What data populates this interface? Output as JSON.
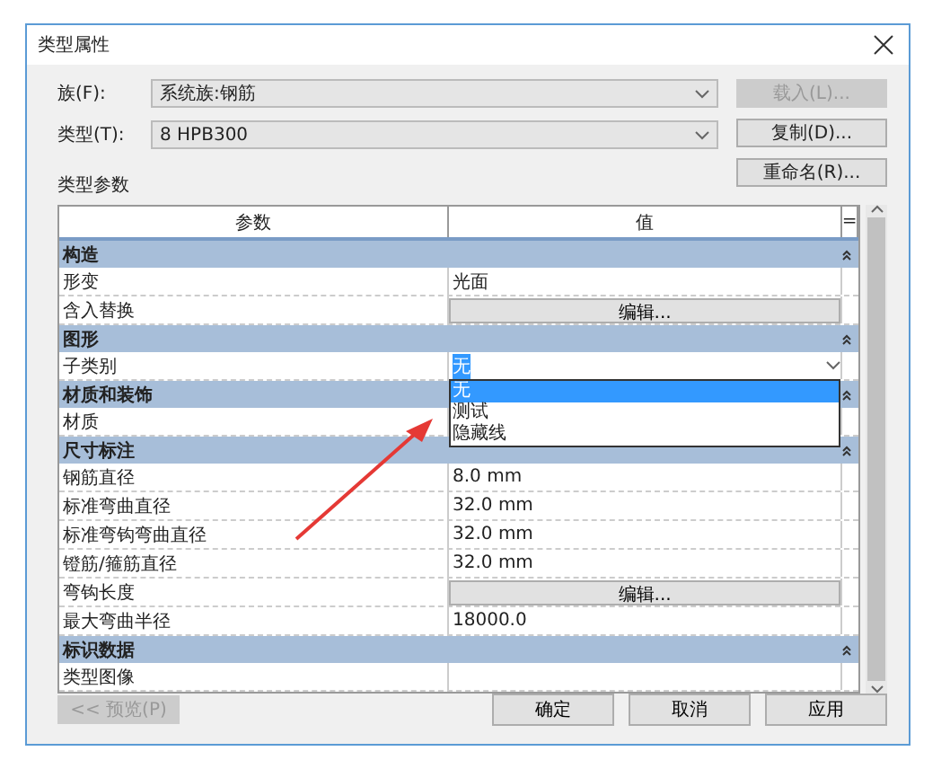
{
  "window": {
    "title": "类型属性"
  },
  "fields": [
    {
      "label": "族(F):",
      "value": "系统族:钢筋"
    },
    {
      "label": "类型(T):",
      "value": "8 HPB300"
    }
  ],
  "side_buttons": [
    {
      "label": "载入(L)...",
      "disabled": true
    },
    {
      "label": "复制(D)...",
      "disabled": false
    },
    {
      "label": "重命名(R)...",
      "disabled": false
    }
  ],
  "section_label": "类型参数",
  "table": {
    "columns": [
      "参数",
      "值"
    ],
    "sort_marker": "=",
    "groups": [
      {
        "name": "构造",
        "rows": [
          {
            "kind": "text",
            "param": "形变",
            "value": "光面"
          },
          {
            "kind": "button",
            "param": "含入替换",
            "value": "编辑..."
          }
        ]
      },
      {
        "name": "图形",
        "rows": [
          {
            "kind": "select",
            "param": "子类别",
            "value": "无",
            "options": [
              {
                "label": "无",
                "selected": true
              },
              {
                "label": "测试",
                "selected": false
              },
              {
                "label": "隐藏线",
                "selected": false
              }
            ]
          }
        ]
      },
      {
        "name": "材质和装饰",
        "rows": [
          {
            "kind": "text",
            "param": "材质",
            "value": ""
          }
        ]
      },
      {
        "name": "尺寸标注",
        "rows": [
          {
            "kind": "text",
            "param": "钢筋直径",
            "value": "8.0 mm"
          },
          {
            "kind": "text",
            "param": "标准弯曲直径",
            "value": "32.0 mm"
          },
          {
            "kind": "text",
            "param": "标准弯钩弯曲直径",
            "value": "32.0 mm"
          },
          {
            "kind": "text",
            "param": "镫筋/箍筋直径",
            "value": "32.0 mm"
          },
          {
            "kind": "button",
            "param": "弯钩长度",
            "value": "编辑..."
          },
          {
            "kind": "text",
            "param": "最大弯曲半径",
            "value": "18000.0"
          }
        ]
      },
      {
        "name": "标识数据",
        "rows": [
          {
            "kind": "text",
            "param": "类型图像",
            "value": ""
          }
        ]
      }
    ]
  },
  "preview_button": {
    "label": "<< 预览(P)",
    "disabled": true
  },
  "buttons": [
    "确定",
    "取消",
    "应用"
  ]
}
